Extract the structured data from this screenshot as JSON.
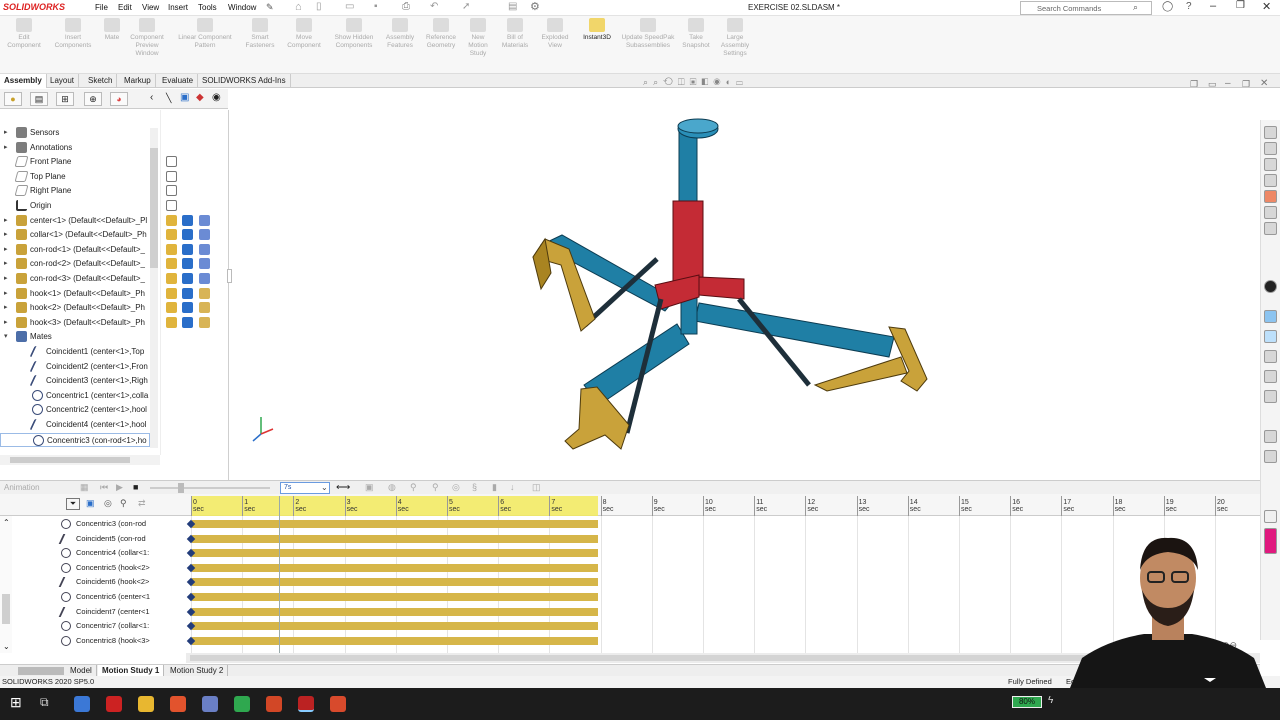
{
  "app": {
    "logo": "SOLIDWORKS",
    "doc_title": "EXERCISE 02.SLDASM *"
  },
  "menus": [
    "File",
    "Edit",
    "View",
    "Insert",
    "Tools",
    "Window"
  ],
  "search": {
    "placeholder": "Search Commands"
  },
  "command_manager": [
    {
      "label": "Edit Component"
    },
    {
      "label": "Insert Components"
    },
    {
      "label": "Mate"
    },
    {
      "label": "Component Preview Window"
    },
    {
      "label": "Linear Component Pattern"
    },
    {
      "label": "Smart Fasteners"
    },
    {
      "label": "Move Component"
    },
    {
      "label": "Show Hidden Components"
    },
    {
      "label": "Assembly Features"
    },
    {
      "label": "Reference Geometry"
    },
    {
      "label": "New Motion Study"
    },
    {
      "label": "Bill of Materials"
    },
    {
      "label": "Exploded View"
    },
    {
      "label": "Instant3D"
    },
    {
      "label": "Update SpeedPak Subassemblies"
    },
    {
      "label": "Take Snapshot"
    },
    {
      "label": "Large Assembly Settings"
    }
  ],
  "tabs": [
    "Assembly",
    "Layout",
    "Sketch",
    "Markup",
    "Evaluate",
    "SOLIDWORKS Add-Ins"
  ],
  "tree": [
    {
      "label": "Sensors",
      "kind": "folder"
    },
    {
      "label": "Annotations",
      "kind": "folder"
    },
    {
      "label": "Front Plane",
      "kind": "plane"
    },
    {
      "label": "Top Plane",
      "kind": "plane"
    },
    {
      "label": "Right Plane",
      "kind": "plane"
    },
    {
      "label": "Origin",
      "kind": "origin"
    },
    {
      "label": "center<1> (Default<<Default>_Pl",
      "kind": "part"
    },
    {
      "label": "collar<1> (Default<<Default>_Ph",
      "kind": "part"
    },
    {
      "label": "con-rod<1> (Default<<Default>_",
      "kind": "part"
    },
    {
      "label": "con-rod<2> (Default<<Default>_",
      "kind": "part"
    },
    {
      "label": "con-rod<3> (Default<<Default>_",
      "kind": "part"
    },
    {
      "label": "hook<1> (Default<<Default>_Ph",
      "kind": "part"
    },
    {
      "label": "hook<2> (Default<<Default>_Ph",
      "kind": "part"
    },
    {
      "label": "hook<3> (Default<<Default>_Ph",
      "kind": "part"
    },
    {
      "label": "Mates",
      "kind": "mates"
    },
    {
      "label": "Coincident1 (center<1>,Top",
      "kind": "coincident"
    },
    {
      "label": "Coincident2 (center<1>,Fron",
      "kind": "coincident"
    },
    {
      "label": "Coincident3 (center<1>,Righ",
      "kind": "coincident"
    },
    {
      "label": "Concentric1 (center<1>,colla",
      "kind": "concentric"
    },
    {
      "label": "Concentric2 (center<1>,hool",
      "kind": "concentric"
    },
    {
      "label": "Coincident4 (center<1>,hool",
      "kind": "coincident"
    },
    {
      "label": "Concentric3 (con-rod<1>,ho",
      "kind": "concentric"
    }
  ],
  "animation": {
    "mode": "Animation",
    "combo_value": "7s"
  },
  "timeline": {
    "ticks": [
      "0 sec",
      "1 sec",
      "2 sec",
      "3 sec",
      "4 sec",
      "5 sec",
      "6 sec",
      "7 sec",
      "8 sec",
      "9 sec",
      "10 sec",
      "11 sec",
      "12 sec",
      "13 sec",
      "14 sec",
      "15 sec",
      "16 sec",
      "17 sec",
      "18 sec",
      "19 sec",
      "20 sec"
    ],
    "duration_sec": 8,
    "rows": [
      {
        "label": "Concentric3 (con-rod",
        "kind": "concentric"
      },
      {
        "label": "Coincident5 (con-rod",
        "kind": "coincident"
      },
      {
        "label": "Concentric4 (collar<1:",
        "kind": "concentric"
      },
      {
        "label": "Concentric5 (hook<2>",
        "kind": "concentric"
      },
      {
        "label": "Coincident6 (hook<2>",
        "kind": "coincident"
      },
      {
        "label": "Concentric6 (center<1",
        "kind": "concentric"
      },
      {
        "label": "Coincident7 (center<1",
        "kind": "coincident"
      },
      {
        "label": "Concentric7 (collar<1:",
        "kind": "concentric"
      },
      {
        "label": "Concentric8 (hook<3>",
        "kind": "concentric"
      }
    ]
  },
  "bottom_tabs": [
    "Model",
    "Motion Study 1",
    "Motion Study 2"
  ],
  "status": {
    "version": "SOLIDWORKS 2020 SP5.0",
    "state": "Fully Defined",
    "edit": "Ec"
  },
  "taskbar": {
    "battery": "80%"
  },
  "colors": {
    "part_blue": "#1f7fa5",
    "collar_red": "#c42b35",
    "hook_gold": "#c9a23a",
    "timeline_bar": "#d6b649",
    "ruler_yellow": "#f2ea5c"
  }
}
